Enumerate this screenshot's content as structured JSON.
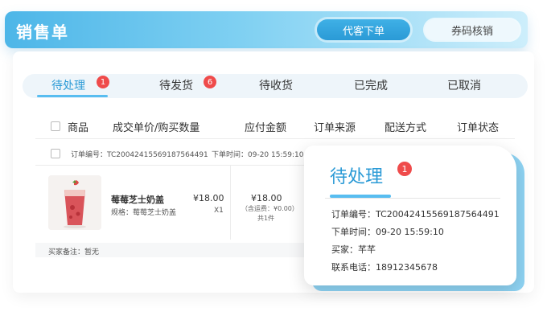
{
  "header": {
    "title": "销售单",
    "proxy_order_button": "代客下单",
    "coupon_verify_button": "券码核销"
  },
  "tabs": [
    {
      "label": "待处理",
      "badge": "1"
    },
    {
      "label": "待发货",
      "badge": "6"
    },
    {
      "label": "待收货"
    },
    {
      "label": "已完成"
    },
    {
      "label": "已取消"
    }
  ],
  "table": {
    "columns": [
      "商品",
      "成交单价/购买数量",
      "应付金额",
      "订单来源",
      "配送方式",
      "订单状态"
    ]
  },
  "order": {
    "order_no": "订单编号：TC20042415569187564491",
    "order_time": "下单时间：09-20 15:59:10",
    "product": {
      "name": "莓莓芝士奶盖",
      "spec": "规格：莓莓芝士奶盖",
      "price": "¥18.00",
      "qty": "X1"
    },
    "total": "¥18.00",
    "total_note": "（含运费：¥0.00）",
    "total_count": "共1件",
    "remark": "买家备注：暂无"
  },
  "popup": {
    "title": "待处理",
    "badge": "1",
    "order_no": "订单编号：TC20042415569187564491",
    "order_time": "下单时间：09-20 15:59:10",
    "buyer": "买家：芊芊",
    "phone": "联系电话：18912345678"
  },
  "colors": {
    "accent": "#2a9ad6",
    "badge": "#ef4b4b",
    "header_gradient_start": "#4db6e8"
  }
}
